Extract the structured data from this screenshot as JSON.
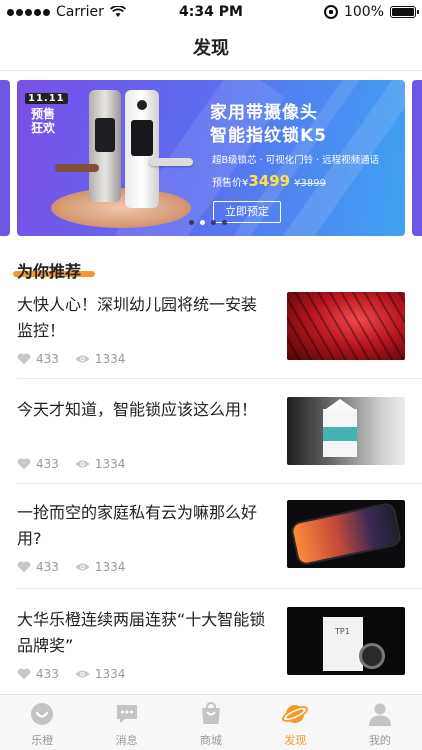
{
  "status_bar": {
    "carrier": "Carrier",
    "time": "4:34 PM",
    "battery": "100%"
  },
  "nav": {
    "title": "发现"
  },
  "banner": {
    "promo_date": "11.11",
    "promo_line1": "预售",
    "promo_line2": "狂欢",
    "headline1": "家用带摄像头",
    "headline2": "智能指纹锁K5",
    "features": "超B级锁芯 · 可视化门铃 · 远程视频通话",
    "presale_label": "预售价¥",
    "price": "3499",
    "original_price": "¥3899",
    "button": "立即预定",
    "pages": 4,
    "active_page": 1
  },
  "section": {
    "title": "为你推荐"
  },
  "articles": [
    {
      "title": "大快人心！深圳幼儿园将统一安装监控！",
      "likes": "433",
      "views": "1334"
    },
    {
      "title": "今天才知道，智能锁应该这么用！",
      "likes": "433",
      "views": "1334"
    },
    {
      "title": "一抢而空的家庭私有云为嘛那么好用?",
      "likes": "433",
      "views": "1334"
    },
    {
      "title": "大华乐橙连续两届连获“十大智能锁品牌奖”",
      "likes": "433",
      "views": "1334"
    }
  ],
  "thumb4_label": "TP1",
  "tabbar": {
    "items": [
      {
        "label": "乐橙",
        "icon": "smile-icon"
      },
      {
        "label": "消息",
        "icon": "message-icon"
      },
      {
        "label": "商城",
        "icon": "shopping-bag-icon"
      },
      {
        "label": "发现",
        "icon": "planet-icon"
      },
      {
        "label": "我的",
        "icon": "person-icon"
      }
    ],
    "active_index": 3
  },
  "colors": {
    "accent": "#f39a2e",
    "banner_start": "#7b4fe8",
    "banner_end": "#3fa2f2",
    "price": "#ffe04a"
  }
}
